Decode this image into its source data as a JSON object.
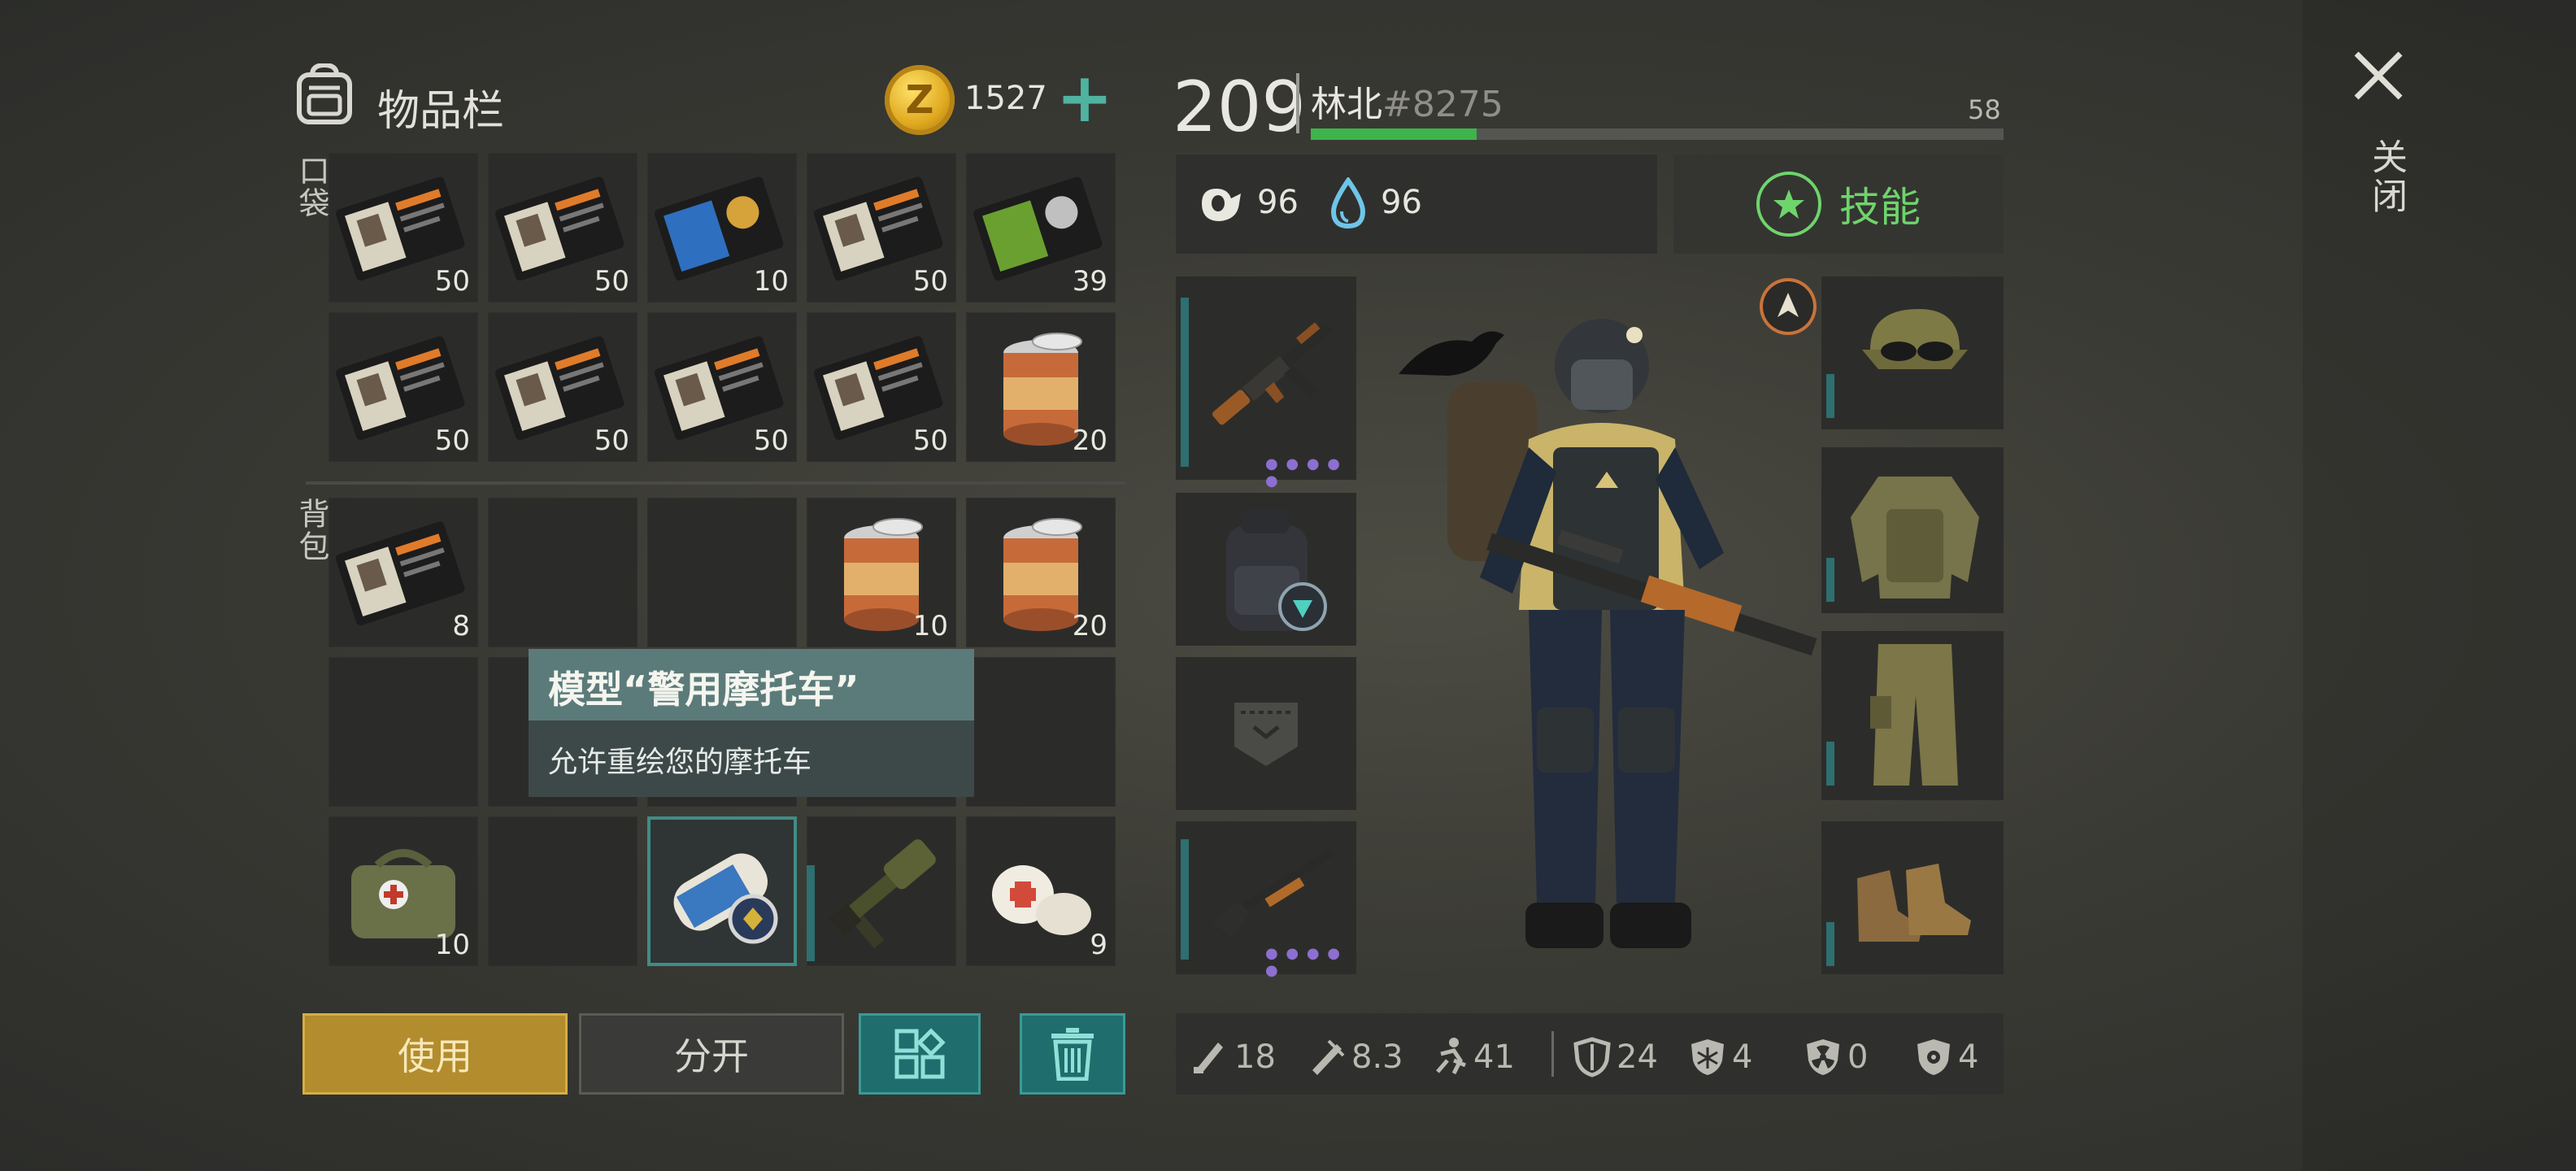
{
  "inventory": {
    "title": "物品栏",
    "coins": "1527",
    "add_symbol": "+",
    "pocket_label": "口袋",
    "backpack_label": "背包",
    "pocket_slots": [
      {
        "item": "police-id-card-icon",
        "qty": "50"
      },
      {
        "item": "police-id-card-icon",
        "qty": "50"
      },
      {
        "item": "blue-badge-card-icon",
        "qty": "10"
      },
      {
        "item": "police-id-card-icon",
        "qty": "50"
      },
      {
        "item": "green-badge-card-icon",
        "qty": "39"
      },
      {
        "item": "police-id-card-icon",
        "qty": "50"
      },
      {
        "item": "police-id-card-icon",
        "qty": "50"
      },
      {
        "item": "police-id-card-icon",
        "qty": "50"
      },
      {
        "item": "police-id-card-icon",
        "qty": "50"
      },
      {
        "item": "canned-food-icon",
        "qty": "20"
      }
    ],
    "backpack_slots": [
      {
        "item": "police-id-card-icon",
        "qty": "8"
      },
      {
        "item": "",
        "qty": ""
      },
      {
        "item": "",
        "qty": ""
      },
      {
        "item": "canned-food-icon",
        "qty": "10"
      },
      {
        "item": "canned-food-icon",
        "qty": "20"
      },
      {
        "item": "",
        "qty": ""
      },
      {
        "item": "",
        "qty": ""
      },
      {
        "item": "",
        "qty": ""
      },
      {
        "item": "",
        "qty": ""
      },
      {
        "item": "",
        "qty": ""
      },
      {
        "item": "medkit-bag-icon",
        "qty": "10"
      },
      {
        "item": "",
        "qty": ""
      },
      {
        "item": "motorcycle-skin-scroll-icon",
        "qty": ""
      },
      {
        "item": "grenade-launcher-icon",
        "qty": ""
      },
      {
        "item": "bandage-icon",
        "qty": "9"
      }
    ],
    "tooltip": {
      "title": "模型“警用摩托车”",
      "description": "允许重绘您的摩托车"
    },
    "buttons": {
      "use": "使用",
      "split": "分开"
    }
  },
  "player": {
    "level": "209",
    "name": "林北",
    "tag": "#8275",
    "xp_next": "58",
    "xp_progress": 0.24,
    "hunger": "96",
    "thirst": "96",
    "skills_label": "技能"
  },
  "equipment": {
    "left": [
      "ak-rifle-icon",
      "tactical-backpack-icon",
      "pocket-slot-icon",
      "shotgun-icon"
    ],
    "right": [
      "camo-cap-icon",
      "camo-jacket-icon",
      "camo-pants-icon",
      "boots-icon"
    ]
  },
  "bottom_stats": [
    {
      "icon": "melee-damage-icon",
      "value": "18"
    },
    {
      "icon": "ranged-damage-icon",
      "value": "8.3"
    },
    {
      "icon": "speed-icon",
      "value": "41"
    },
    {
      "icon": "armor-icon",
      "value": "24"
    },
    {
      "icon": "cold-resist-icon",
      "value": "4"
    },
    {
      "icon": "radiation-resist-icon",
      "value": "0"
    },
    {
      "icon": "infection-resist-icon",
      "value": "4"
    }
  ],
  "close_label": "关闭",
  "colors": {
    "accent_teal": "#3b9a96",
    "accent_gold": "#b38c2e",
    "xp_green": "#3fb34c",
    "skill_green": "#6fd46c"
  }
}
